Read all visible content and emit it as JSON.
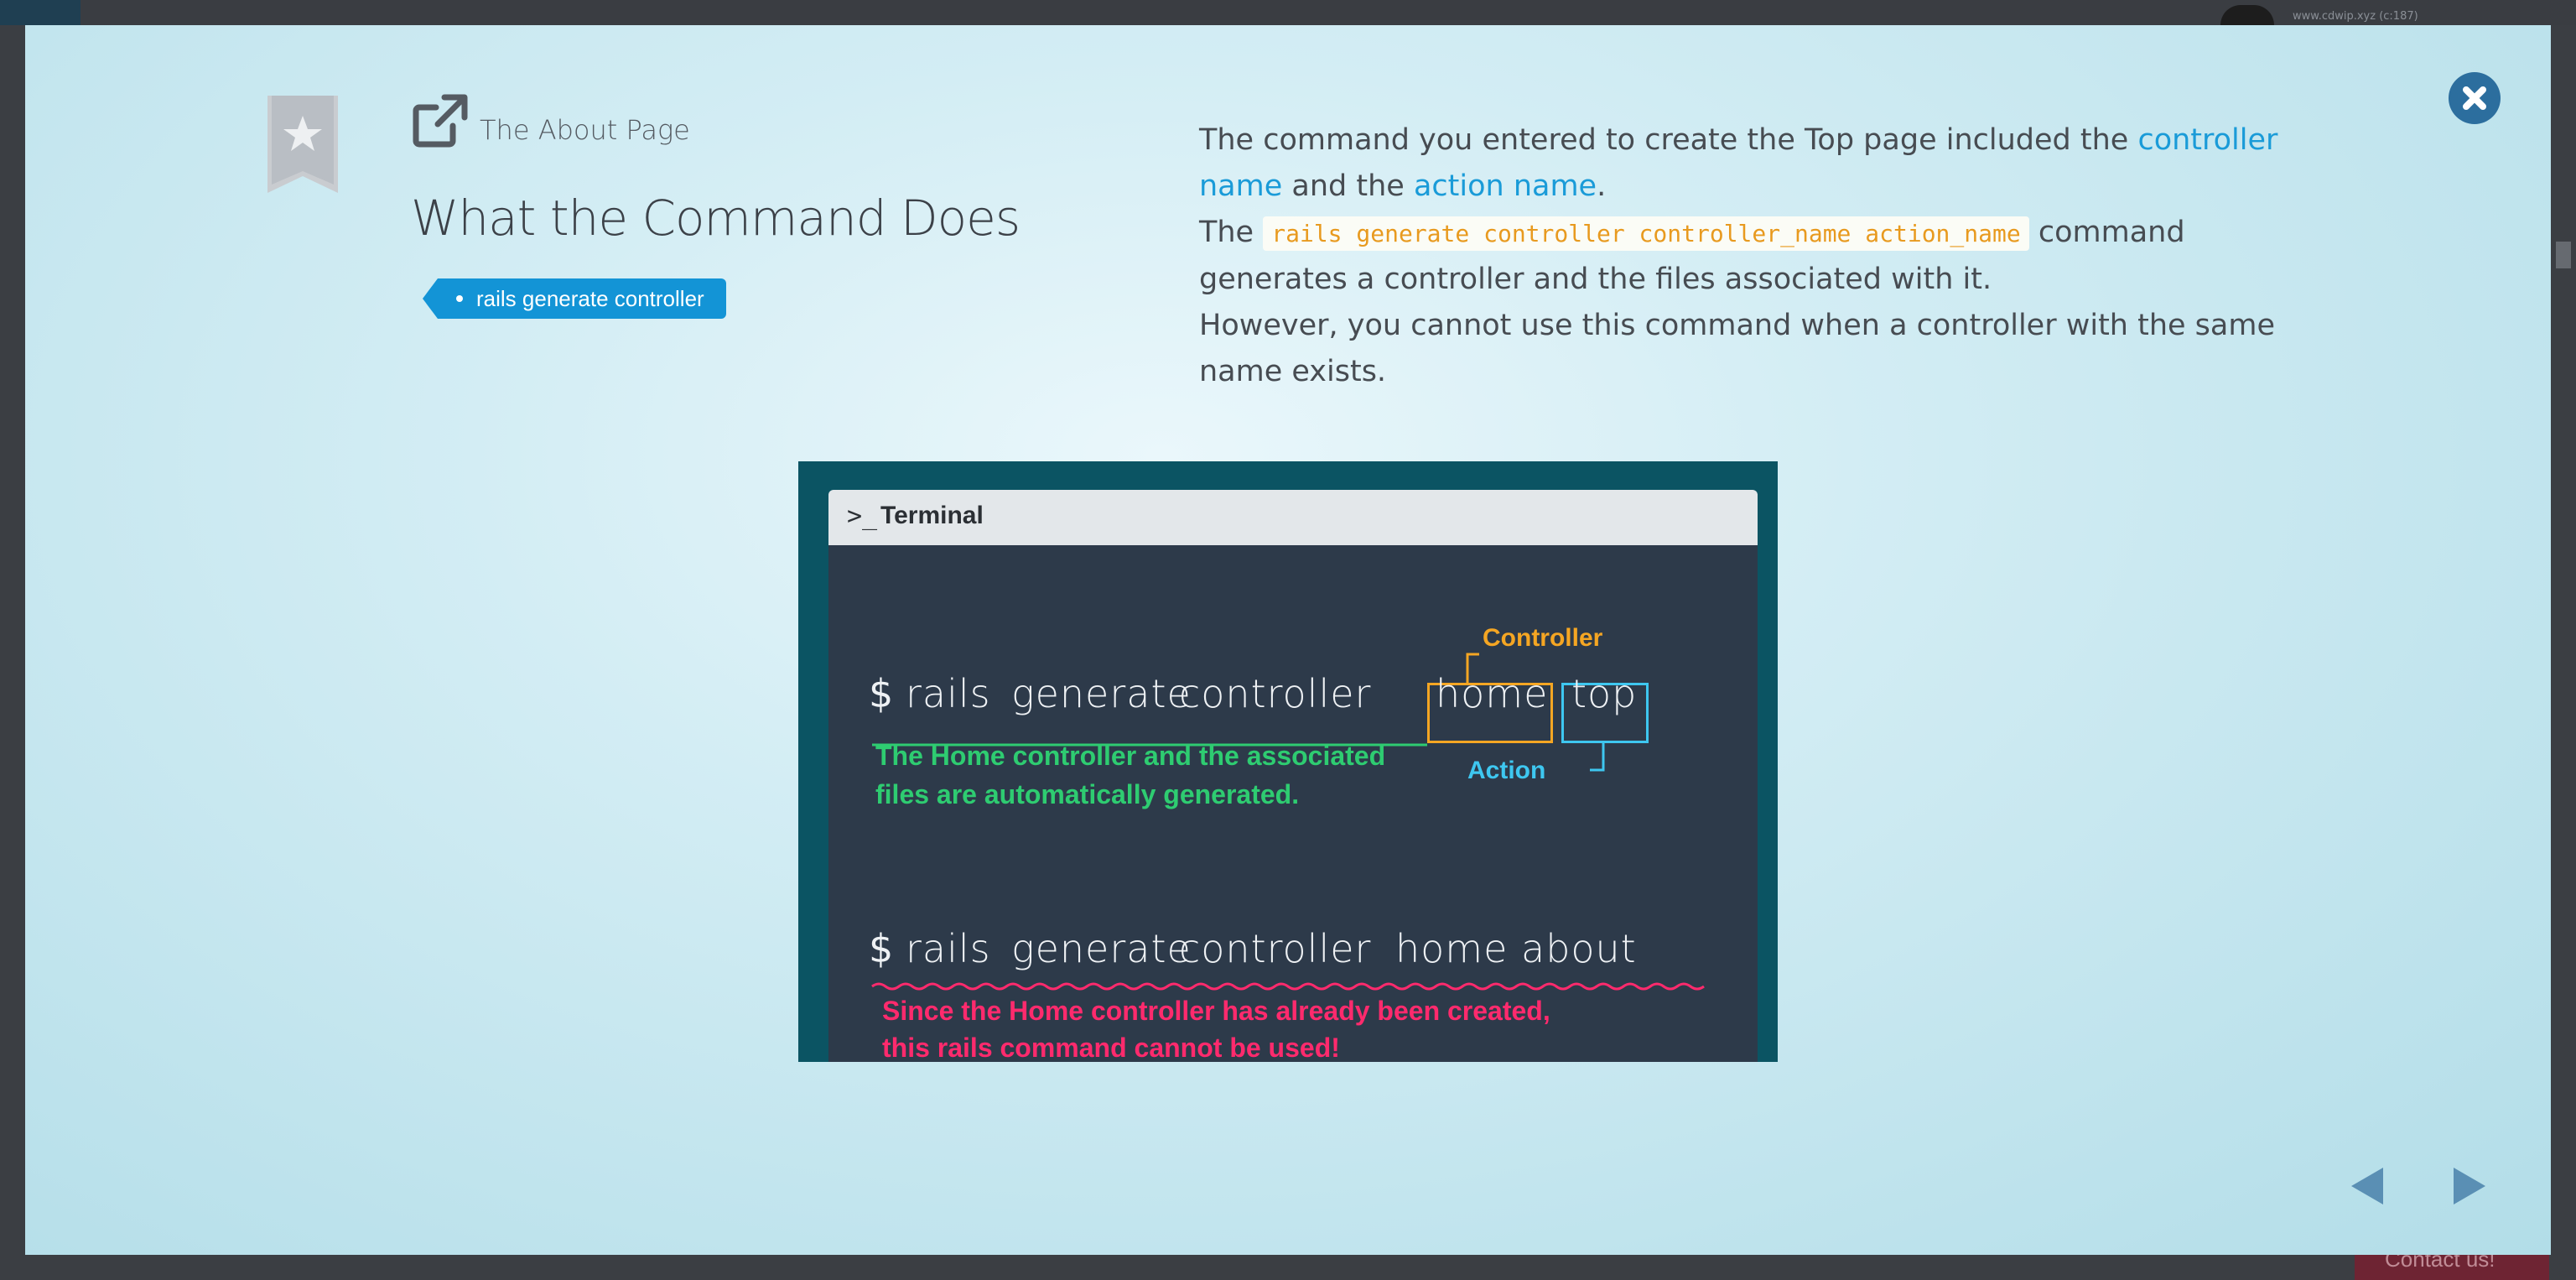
{
  "background": {
    "url_text": "www.cdwip.xyz (c:187)",
    "contact_label": "Contact us!"
  },
  "modal": {
    "eyebrow": "The About Page",
    "title": "What the Command Does",
    "tag": "rails generate controller",
    "description": {
      "line1_text": "The command you entered to create the Top page included the",
      "link_controller": "controller name",
      "and_text": "and the",
      "link_action": "action name",
      "period": ".",
      "the_word": "The",
      "code": "rails generate controller controller_name action_name",
      "after_code": "command generates a controller and the files associated with it.",
      "line3": "However, you cannot use this command when a controller with the same name exists."
    }
  },
  "terminal": {
    "prompt_symbol": ">_",
    "title": "Terminal",
    "dollar": "$",
    "cmd1_words": [
      "rails",
      "generate",
      "controller"
    ],
    "cmd1_controller": "home",
    "cmd1_action": "top",
    "label_controller": "Controller",
    "label_action": "Action",
    "note1_line1": "The Home controller and the associated",
    "note1_line2": "files are automatically generated.",
    "cmd2_words": [
      "rails",
      "generate",
      "controller",
      "home",
      "about"
    ],
    "note2_line1": "Since the Home controller has already been created,",
    "note2_line2": "this rails command cannot be used!"
  },
  "colors": {
    "accent_blue": "#1394d6",
    "link_blue": "#1a9bd8",
    "code_orange": "#e89a1f",
    "controller_orange": "#f5a623",
    "action_cyan": "#3ec7f0",
    "success_green": "#2ecc71",
    "error_pink": "#ff2a6d",
    "close_button": "#2c6e9e"
  },
  "icons": {
    "bookmark": "bookmark-star-icon",
    "eyebrow": "external-link-icon",
    "close": "close-icon",
    "prev": "arrow-left-icon",
    "next": "arrow-right-icon"
  }
}
